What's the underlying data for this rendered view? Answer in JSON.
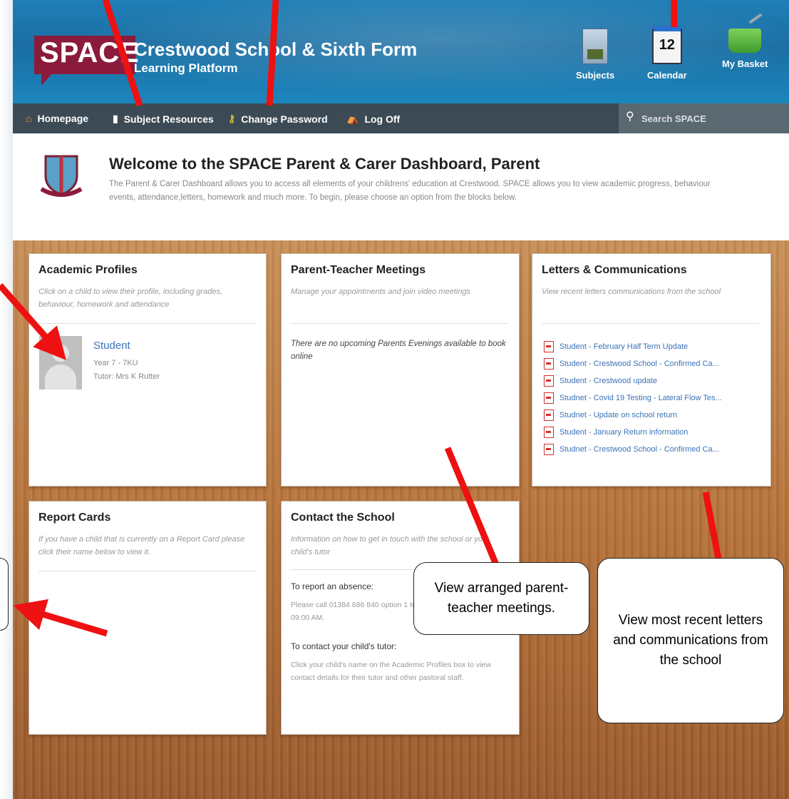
{
  "header": {
    "logo": "SPACE",
    "school_name": "Crestwood School & Sixth Form",
    "platform": "Learning Platform",
    "icons": [
      {
        "label": "Subjects",
        "icon": "book-icon"
      },
      {
        "label": "Calendar",
        "icon": "calendar-icon",
        "date": "12"
      },
      {
        "label": "My Basket",
        "icon": "basket-icon"
      }
    ]
  },
  "nav": {
    "items": [
      {
        "label": "Homepage",
        "icon": "home-icon"
      },
      {
        "label": "Subject Resources",
        "icon": "book-icon"
      },
      {
        "label": "Change Password",
        "icon": "key-icon"
      },
      {
        "label": "Log Off",
        "icon": "logoff-icon"
      }
    ],
    "search_placeholder": "Search SPACE"
  },
  "welcome": {
    "title": "Welcome to the SPACE Parent & Carer Dashboard, Parent",
    "text": "The Parent & Carer Dashboard allows you to access all elements of your childrens' education at Crestwood. SPACE allows you to view academic progress, behaviour events, attendance,letters, homework and much more. To begin, please choose an option from the blocks below."
  },
  "cards": {
    "academic": {
      "title": "Academic Profiles",
      "subtitle": "Click on a child to view their profile, including grades, behaviour, homework and attendance",
      "student": {
        "name": "Student",
        "year": "Year 7 - 7KU",
        "tutor": "Tutor: Mrs K Rutter"
      }
    },
    "meetings": {
      "title": "Parent-Teacher Meetings",
      "subtitle": "Manage your appointments and join video meetings",
      "empty": "There are no upcoming Parents Evenings available to book online"
    },
    "letters": {
      "title": "Letters & Communications",
      "subtitle": "View recent letters communications from the school",
      "items": [
        "Student - February Half Term Update",
        "Student - Crestwood School - Confirmed Ca...",
        "Student - Crestwood update",
        "Studnet - Covid 19 Testing - Lateral Flow Tes...",
        "Studnet - Update on school return",
        "Student - January Return information",
        "Studnet - Crestwood School - Confirmed Ca..."
      ]
    },
    "report": {
      "title": "Report Cards",
      "subtitle": "If you have a child that is currently on a Report Card please click their name below to view it."
    },
    "contact": {
      "title": "Contact the School",
      "subtitle": "Information on how to get in touch with the school or your child's tutor",
      "absence_heading": "To report an absence:",
      "absence_text": "Please call 01384 686 840 option 1 to report the absence, before 09:00 AM.",
      "tutor_heading": "To contact your child's tutor:",
      "tutor_text": "Click your child's name on the Academic Profiles box to view contact details for their tutor and other pastoral staff."
    }
  },
  "callouts": {
    "meetings": "View arranged parent-teacher meetings.",
    "letters": "View most recent letters and communications from the school"
  },
  "colors": {
    "arrow": "#ee1111",
    "header": "#1f7fb6",
    "nav": "#3b4a54",
    "logo": "#8b1b3c",
    "link": "#3a72b8"
  }
}
